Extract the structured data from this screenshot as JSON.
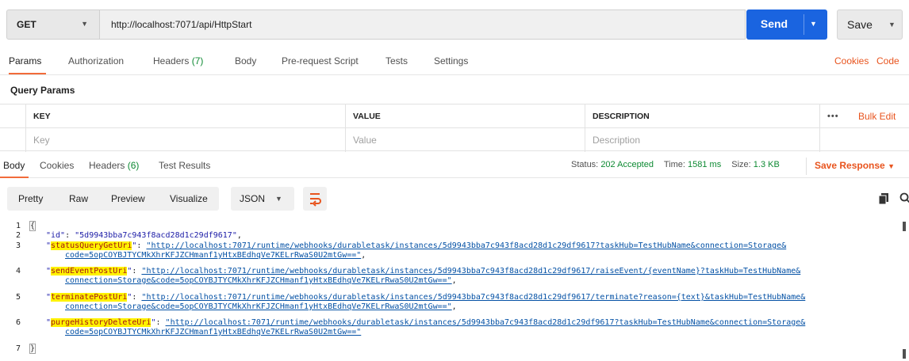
{
  "request": {
    "method": "GET",
    "url": "http://localhost:7071/api/HttpStart",
    "send_label": "Send",
    "save_label": "Save"
  },
  "request_tabs": [
    {
      "label": "Params",
      "active": true
    },
    {
      "label": "Authorization"
    },
    {
      "label": "Headers",
      "count": "(7)"
    },
    {
      "label": "Body"
    },
    {
      "label": "Pre-request Script"
    },
    {
      "label": "Tests"
    },
    {
      "label": "Settings"
    }
  ],
  "right_links": {
    "cookies": "Cookies",
    "code": "Code"
  },
  "query_params": {
    "title": "Query Params",
    "headers": {
      "key": "KEY",
      "value": "VALUE",
      "description": "DESCRIPTION"
    },
    "placeholders": {
      "key": "Key",
      "value": "Value",
      "description": "Description"
    },
    "more": "•••",
    "bulk_edit": "Bulk Edit"
  },
  "response_tabs": [
    {
      "label": "Body",
      "active": true
    },
    {
      "label": "Cookies"
    },
    {
      "label": "Headers",
      "count": "(6)"
    },
    {
      "label": "Test Results"
    }
  ],
  "response_status": {
    "status_label": "Status:",
    "status_value": "202 Accepted",
    "time_label": "Time:",
    "time_value": "1581 ms",
    "size_label": "Size:",
    "size_value": "1.3 KB",
    "save_response": "Save Response"
  },
  "view": {
    "modes": [
      "Pretty",
      "Raw",
      "Preview",
      "Visualize"
    ],
    "format": "JSON"
  },
  "code": {
    "line_numbers": [
      "1",
      "2",
      "3",
      "4",
      "5",
      "6",
      "7"
    ],
    "open_brace": "{",
    "close_brace": "}",
    "id_key": "\"id\"",
    "id_value": "\"5d9943bba7c943f8acd28d1c29df9617\"",
    "status_key": "statusQueryGetUri",
    "status_value_1": "\"http://localhost:7071/runtime/webhooks/durabletask/instances/5d9943bba7c943f8acd28d1c29df9617?taskHub=TestHubName&connection=Storage&",
    "status_value_2": "code=5opCOYBJTYCMkXhrKFJZCHmanf1yHtxBEdhqVe7KELrRwaS0U2mtGw==\"",
    "send_key": "sendEventPostUri",
    "send_value_1": "\"http://localhost:7071/runtime/webhooks/durabletask/instances/5d9943bba7c943f8acd28d1c29df9617/raiseEvent/{eventName}?taskHub=TestHubName&",
    "send_value_2": "connection=Storage&code=5opCOYBJTYCMkXhrKFJZCHmanf1yHtxBEdhqVe7KELrRwaS0U2mtGw==\"",
    "terminate_key": "terminatePostUri",
    "terminate_value_1": "\"http://localhost:7071/runtime/webhooks/durabletask/instances/5d9943bba7c943f8acd28d1c29df9617/terminate?reason={text}&taskHub=TestHubName&",
    "terminate_value_2": "connection=Storage&code=5opCOYBJTYCMkXhrKFJZCHmanf1yHtxBEdhqVe7KELrRwaS0U2mtGw==\"",
    "purge_key": "purgeHistoryDeleteUri",
    "purge_value_1": "\"http://localhost:7071/runtime/webhooks/durabletask/instances/5d9943bba7c943f8acd28d1c29df9617?taskHub=TestHubName&connection=Storage&",
    "purge_value_2": "code=5opCOYBJTYCMkXhrKFJZCHmanf1yHtxBEdhqVe7KELrRwaS0U2mtGw==\""
  },
  "colors": {
    "accent": "#f26b3a",
    "send": "#1a64e0",
    "link": "#e8541e",
    "success": "#0e8a33",
    "highlight": "#fff200"
  }
}
